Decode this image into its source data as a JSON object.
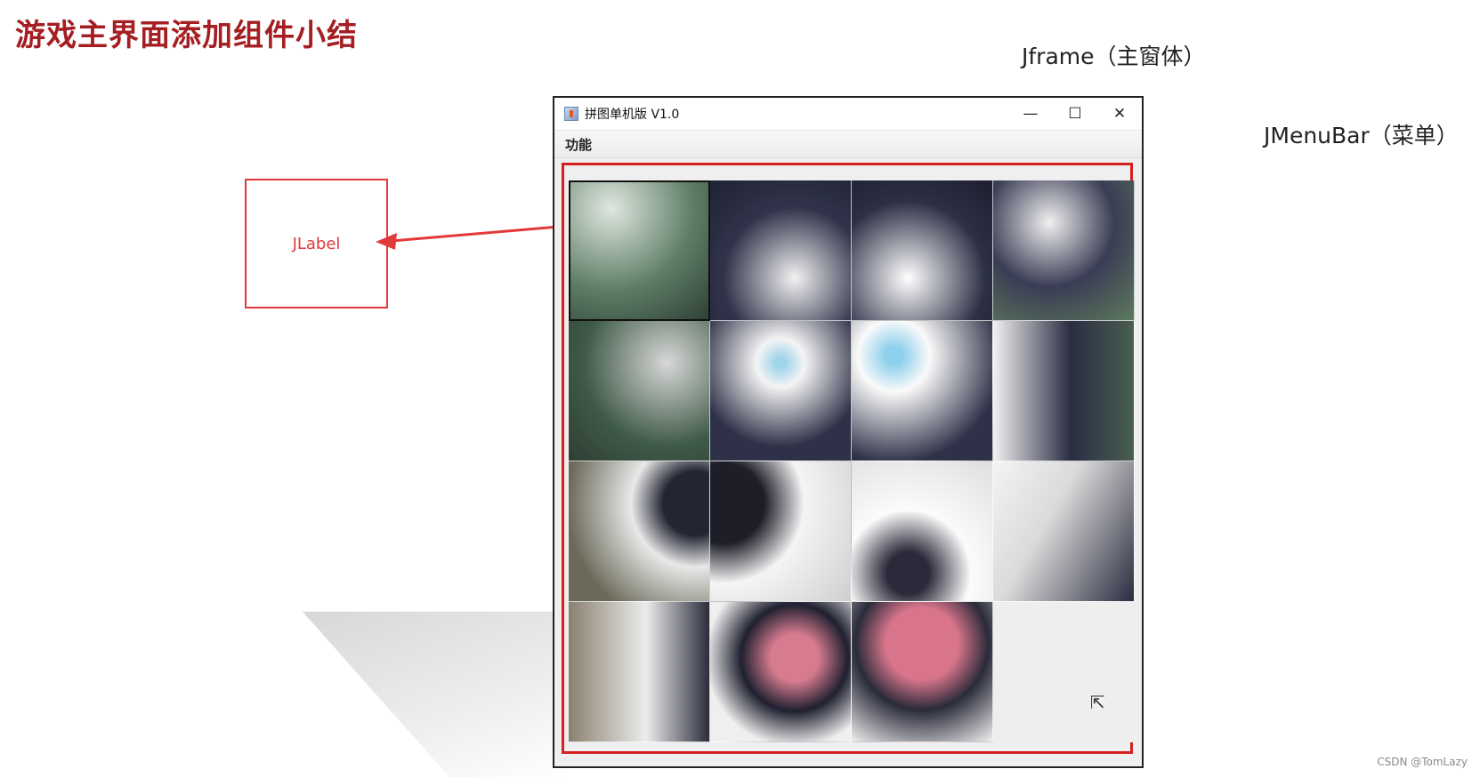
{
  "slide": {
    "title": "游戏主界面添加组件小结",
    "annotations": {
      "jframe": "Jframe（主窗体）",
      "jmenubar": "JMenuBar（菜单）",
      "jlabel": "JLabel"
    },
    "watermark": "CSDN @TomLazy"
  },
  "window": {
    "title": "拼图单机版 V1.0",
    "controls": {
      "minimize": "—",
      "maximize": "☐",
      "close": "✕"
    },
    "menu": [
      "功能"
    ],
    "puzzle": {
      "grid": "4x4",
      "empty_tile": "row 4, col 4",
      "image": "husky dog face"
    }
  },
  "colors": {
    "title_red": "#a51e22",
    "annotation_red": "#e23a3a",
    "frame_red": "#d42020"
  }
}
